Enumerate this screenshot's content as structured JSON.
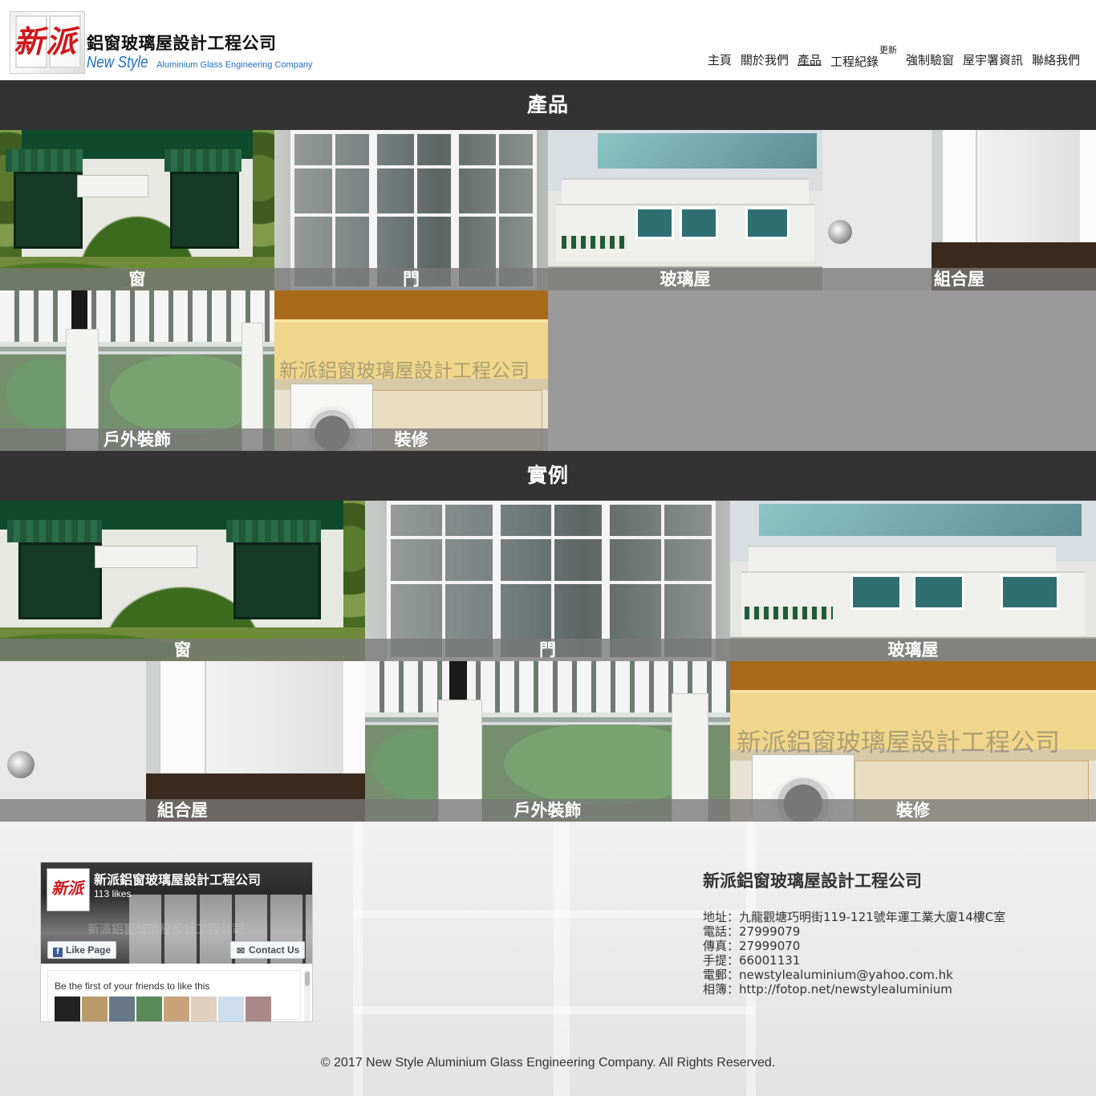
{
  "header": {
    "logo_mark": "新派",
    "logo_cn": "鋁窗玻璃屋設計工程公司",
    "logo_en_big": "New Style",
    "logo_en_small": "Aluminium Glass Engineering Company"
  },
  "nav": {
    "items": [
      {
        "label": "主頁"
      },
      {
        "label": "關於我們"
      },
      {
        "label": "產品"
      },
      {
        "label": "工程紀錄",
        "badge": "更新"
      },
      {
        "label": "強制驗窗"
      },
      {
        "label": "屋宇署資訊"
      },
      {
        "label": "聯絡我們"
      }
    ],
    "active_index": 2
  },
  "products": {
    "title": "產品",
    "tiles": [
      "窗",
      "門",
      "玻璃屋",
      "組合屋",
      "戶外裝飾",
      "裝修"
    ]
  },
  "examples": {
    "title": "實例",
    "tiles": [
      "窗",
      "門",
      "玻璃屋",
      "組合屋",
      "戶外裝飾",
      "裝修"
    ]
  },
  "watermark": "新派鋁窗玻璃屋設計工程公司",
  "facebook": {
    "page_name": "新派鋁窗玻璃屋設計工程公司",
    "likes": "113 likes",
    "like_button": "Like Page",
    "contact_button": "Contact Us",
    "friends_text": "Be the first of your friends to like this",
    "cover_watermark": "新派鋁窗玻璃屋設計工程公司"
  },
  "contact": {
    "title": "新派鋁窗玻璃屋設計工程公司",
    "address": "地址：九龍觀塘巧明街119-121號年運工業大廈14樓C室",
    "phone": "電話：27999079",
    "fax": "傳真：27999070",
    "mobile": "手提：66001131",
    "email": "電郵：newstylealuminium@yahoo.com.hk",
    "album": "相簿：http://fotop.net/newstylealuminium"
  },
  "footer": {
    "copyright": "© 2017 New Style Aluminium Glass Engineering Company. All Rights Reserved."
  },
  "colors": {
    "section_bar": "#333333",
    "caption_overlay": "rgba(120,120,120,0.78)",
    "logo_red": "#d0161b",
    "logo_blue": "#1e6fc4"
  }
}
